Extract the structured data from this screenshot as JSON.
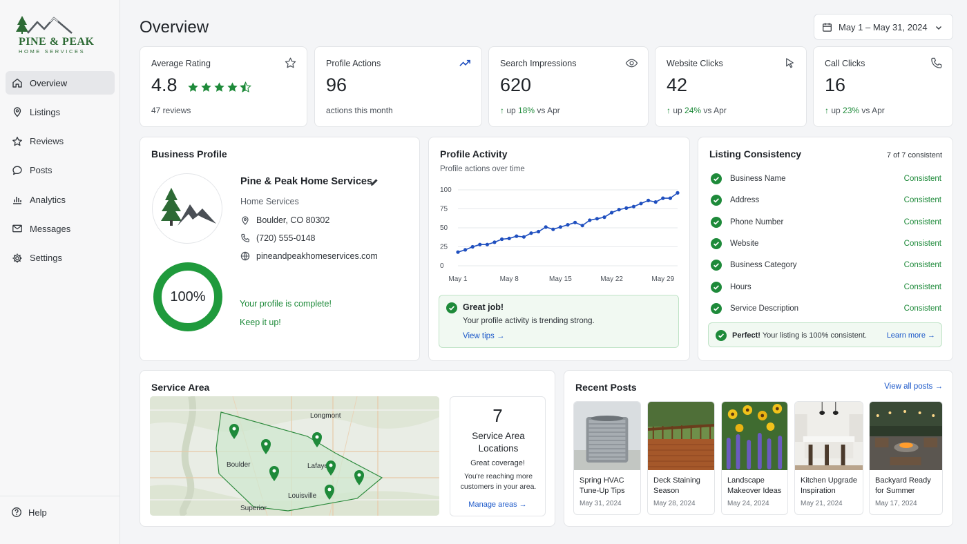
{
  "brand": {
    "line1": "PINE & PEAK",
    "line2": "HOME SERVICES"
  },
  "sidebar": {
    "items": [
      {
        "label": "Overview",
        "icon": "home-icon"
      },
      {
        "label": "Listings",
        "icon": "location-pin-icon"
      },
      {
        "label": "Reviews",
        "icon": "star-icon"
      },
      {
        "label": "Posts",
        "icon": "chat-bubble-icon"
      },
      {
        "label": "Analytics",
        "icon": "bar-chart-icon"
      },
      {
        "label": "Messages",
        "icon": "mail-icon"
      },
      {
        "label": "Settings",
        "icon": "gear-icon"
      }
    ],
    "help": "Help"
  },
  "header": {
    "title": "Overview",
    "date_range": "May 1 – May 31, 2024"
  },
  "stats": {
    "rating": {
      "label": "Average Rating",
      "value": "4.8",
      "rating_stars": 4.5,
      "sub": "47 reviews"
    },
    "profile_actions": {
      "label": "Profile Actions",
      "value": "96",
      "sub": "actions this month"
    },
    "search_impressions": {
      "label": "Search Impressions",
      "value": "620",
      "up": "up",
      "pct": "18%",
      "vs": "vs Apr"
    },
    "website_clicks": {
      "label": "Website Clicks",
      "value": "42",
      "up": "up",
      "pct": "24%",
      "vs": "vs Apr"
    },
    "call_clicks": {
      "label": "Call Clicks",
      "value": "16",
      "up": "up",
      "pct": "23%",
      "vs": "vs Apr"
    }
  },
  "business_profile": {
    "title": "Business Profile",
    "name": "Pine & Peak Home Services",
    "category": "Home Services",
    "address": "Boulder, CO 80302",
    "phone": "(720) 555-0148",
    "website": "pineandpeakhomeservices.com",
    "completion": "100%",
    "complete_msg": "Your profile is complete!",
    "keep_msg": "Keep it up!"
  },
  "profile_activity": {
    "title": "Profile Activity",
    "subtitle": "Profile actions over time",
    "note_title": "Great job!",
    "note_text": "Your profile activity is trending strong.",
    "note_link": "View tips →"
  },
  "chart_data": {
    "type": "line",
    "title": "Profile Activity",
    "subtitle": "Profile actions over time",
    "xlabel": "",
    "ylabel": "",
    "x_ticks": [
      "May 1",
      "May 8",
      "May 15",
      "May 22",
      "May 29"
    ],
    "y_ticks": [
      0,
      25,
      50,
      75,
      100
    ],
    "ylim": [
      0,
      100
    ],
    "grid": "horizontal",
    "color": "#1f4fbf",
    "x": [
      1,
      2,
      3,
      4,
      5,
      6,
      7,
      8,
      9,
      10,
      11,
      12,
      13,
      14,
      15,
      16,
      17,
      18,
      19,
      20,
      21,
      22,
      23,
      24,
      25,
      26,
      27,
      28,
      29,
      30,
      31
    ],
    "values": [
      18,
      21,
      25,
      28,
      28,
      31,
      35,
      36,
      39,
      38,
      43,
      45,
      51,
      48,
      51,
      54,
      57,
      53,
      60,
      62,
      64,
      70,
      74,
      76,
      78,
      82,
      86,
      84,
      89,
      89,
      96
    ]
  },
  "listing_consistency": {
    "title": "Listing Consistency",
    "count": "7 of 7 consistent",
    "rows": [
      {
        "label": "Business Name",
        "status": "Consistent"
      },
      {
        "label": "Address",
        "status": "Consistent"
      },
      {
        "label": "Phone Number",
        "status": "Consistent"
      },
      {
        "label": "Website",
        "status": "Consistent"
      },
      {
        "label": "Business Category",
        "status": "Consistent"
      },
      {
        "label": "Hours",
        "status": "Consistent"
      },
      {
        "label": "Service Description",
        "status": "Consistent"
      }
    ],
    "note_bold": "Perfect!",
    "note_text": " Your listing is 100% consistent.",
    "note_link": "Learn more →"
  },
  "service_area": {
    "title": "Service Area",
    "towns": [
      "Longmont",
      "Boulder",
      "Lafayette",
      "Louisville",
      "Superior"
    ],
    "count": "7",
    "label": "Service Area Locations",
    "good": "Great coverage!",
    "reach": "You're reaching more customers in your area.",
    "manage": "Manage areas →"
  },
  "recent_posts": {
    "title": "Recent Posts",
    "view_all": "View all posts →",
    "posts": [
      {
        "title1": "Spring HVAC",
        "title2": "Tune-Up Tips",
        "date": "May 31, 2024"
      },
      {
        "title1": "Deck Staining",
        "title2": "Season",
        "date": "May 28, 2024"
      },
      {
        "title1": "Landscape",
        "title2": "Makeover Ideas",
        "date": "May 24, 2024"
      },
      {
        "title1": "Kitchen Upgrade",
        "title2": "Inspiration",
        "date": "May 21, 2024"
      },
      {
        "title1": "Backyard Ready",
        "title2": "for Summer",
        "date": "May 17, 2024"
      }
    ]
  },
  "colors": {
    "accent_green": "#1e8a3a",
    "link_blue": "#1a57c9",
    "line_blue": "#1f4fbf"
  }
}
